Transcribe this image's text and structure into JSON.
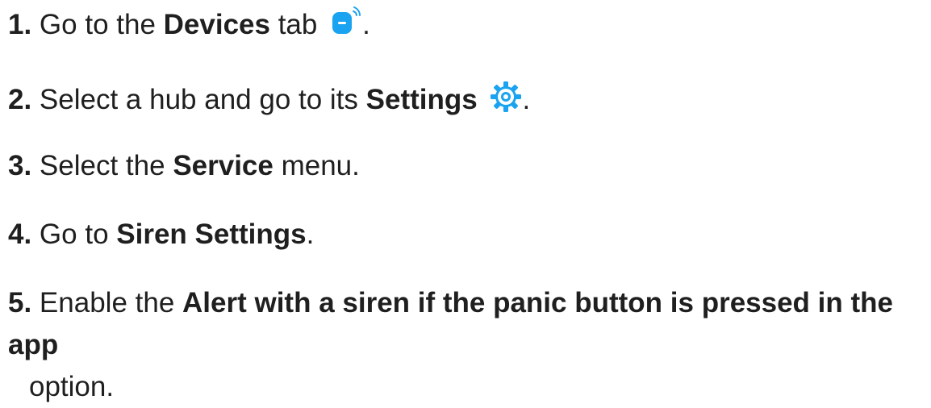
{
  "steps": [
    {
      "num": "1.",
      "pre": " Go to the ",
      "bold": "Devices",
      "post": " tab",
      "end": "."
    },
    {
      "num": "2.",
      "pre": " Select a hub and go to its ",
      "bold": "Settings",
      "end": "."
    },
    {
      "num": "3.",
      "pre": " Select the ",
      "bold": "Service",
      "post": " menu."
    },
    {
      "num": "4.",
      "pre": " Go to ",
      "bold": "Siren Settings",
      "post": "."
    },
    {
      "num": "5.",
      "pre": " Enable the ",
      "bold": "Alert with a siren if the panic button is pressed in the app",
      "post": "option."
    }
  ],
  "icons": {
    "devices": "devices-tab-icon",
    "settings": "settings-gear-icon",
    "accent": "#1aa3f0"
  }
}
